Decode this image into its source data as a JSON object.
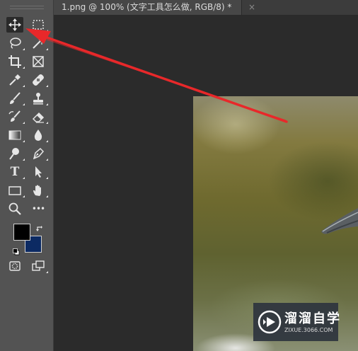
{
  "document_tab": {
    "title": "1.png @ 100% (文字工具怎么做, RGB/8) *",
    "close_glyph": "×"
  },
  "toolbar": {
    "tools": [
      {
        "icon": "move-icon",
        "active": true
      },
      {
        "icon": "rectangular-marquee-icon"
      },
      {
        "icon": "lasso-icon"
      },
      {
        "icon": "magic-wand-icon"
      },
      {
        "icon": "crop-icon"
      },
      {
        "icon": "frame-icon"
      },
      {
        "icon": "eyedropper-icon"
      },
      {
        "icon": "healing-brush-icon"
      },
      {
        "icon": "brush-icon"
      },
      {
        "icon": "clone-stamp-icon"
      },
      {
        "icon": "history-brush-icon"
      },
      {
        "icon": "eraser-icon"
      },
      {
        "icon": "gradient-icon"
      },
      {
        "icon": "blur-icon"
      },
      {
        "icon": "dodge-icon"
      },
      {
        "icon": "pen-icon"
      },
      {
        "icon": "type-icon"
      },
      {
        "icon": "path-selection-icon"
      },
      {
        "icon": "rectangle-shape-icon"
      },
      {
        "icon": "hand-icon"
      },
      {
        "icon": "zoom-icon"
      },
      {
        "icon": "more-tools-icon"
      }
    ],
    "foreground_color": "#000000",
    "background_color": "#0c2a63",
    "type_tool_glyph": "T",
    "more_tools_glyph": "•••"
  },
  "watermark": {
    "title": "溜溜自学",
    "url": "ZIXUE.3066.COM"
  },
  "colors": {
    "toolbar_bg": "#535353",
    "workspace_bg": "#2b2b2b",
    "annotation_arrow": "#e8282a"
  }
}
